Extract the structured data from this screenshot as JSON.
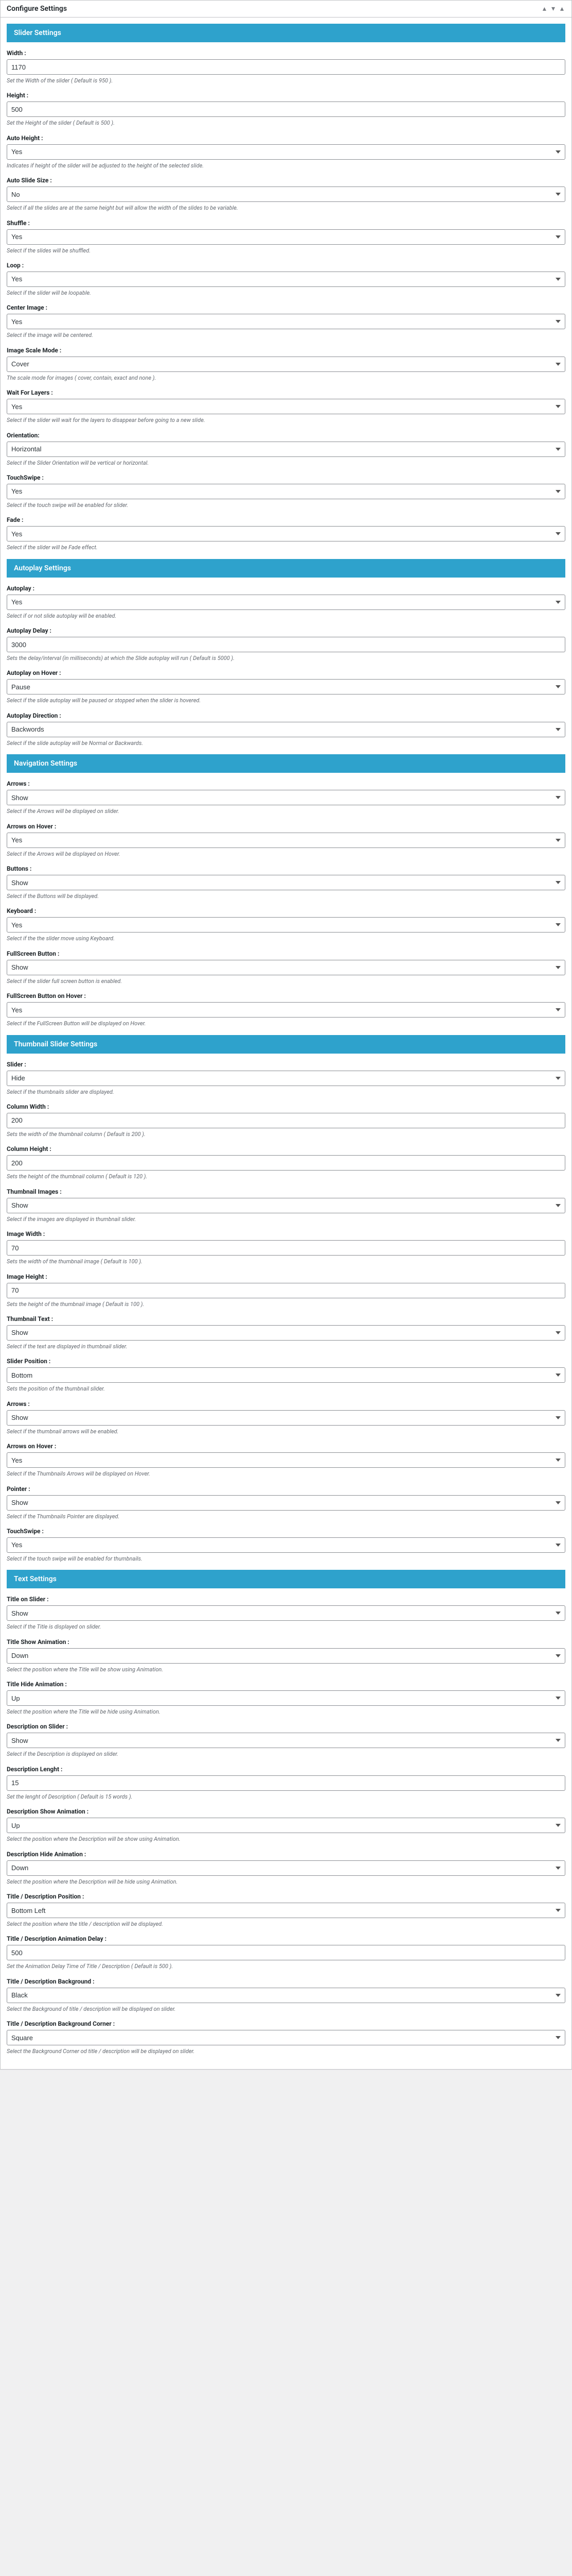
{
  "panel": {
    "title": "Configure Settings"
  },
  "sections": {
    "slider": {
      "title": "Slider Settings",
      "width": {
        "label": "Width :",
        "value": "1170",
        "hint": "Set the Width of the slider ( Default is 950 )."
      },
      "height": {
        "label": "Height :",
        "value": "500",
        "hint": "Set the Height of the slider ( Default is 500 )."
      },
      "autoHeight": {
        "label": "Auto Height :",
        "value": "Yes",
        "hint": "Indicates if height of the slider will be adjusted to the height of the selected slide."
      },
      "autoSlideSize": {
        "label": "Auto Slide Size :",
        "value": "No",
        "hint": "Select if all the slides are at the same height but will allow the width of the slides to be variable."
      },
      "shuffle": {
        "label": "Shuffle :",
        "value": "Yes",
        "hint": "Select if the slides will be shuffled."
      },
      "loop": {
        "label": "Loop :",
        "value": "Yes",
        "hint": "Select if the slider will be loopable."
      },
      "centerImage": {
        "label": "Center Image :",
        "value": "Yes",
        "hint": "Select if the image will be centered."
      },
      "imageScale": {
        "label": "Image Scale Mode :",
        "value": "Cover",
        "hint": "The scale mode for images ( cover, contain, exact and none )."
      },
      "waitLayers": {
        "label": "Wait For Layers :",
        "value": "Yes",
        "hint": "Select if the slider will wait for the layers to disappear before going to a new slide."
      },
      "orientation": {
        "label": "Orientation:",
        "value": "Horizontal",
        "hint": "Select if the Slider Orientation will be vertical or horizontal."
      },
      "touchSwipe": {
        "label": "TouchSwipe :",
        "value": "Yes",
        "hint": "Select if the touch swipe will be enabled for slider."
      },
      "fade": {
        "label": "Fade :",
        "value": "Yes",
        "hint": "Select if the slider will be Fade effect."
      }
    },
    "autoplay": {
      "title": "Autoplay Settings",
      "autoplay": {
        "label": "Autoplay :",
        "value": "Yes",
        "hint": "Select if or not slide autoplay will be enabled."
      },
      "autoplayDelay": {
        "label": "Autoplay Delay :",
        "value": "3000",
        "hint": "Sets the delay/interval (in milliseconds) at which the Slide autoplay will run ( Default is 5000 )."
      },
      "autoplayHover": {
        "label": "Autoplay on Hover :",
        "value": "Pause",
        "hint": "Select if the slide autoplay will be paused or stopped when the slider is hovered."
      },
      "autoplayDir": {
        "label": "Autoplay Direction :",
        "value": "Backwords",
        "hint": "Select if the slide autoplay will be Normal or Backwards."
      }
    },
    "navigation": {
      "title": "Navigation Settings",
      "arrows": {
        "label": "Arrows :",
        "value": "Show",
        "hint": "Select if the Arrows will be displayed on slider.",
        "blue": true
      },
      "arrowsHover": {
        "label": "Arrows on Hover :",
        "value": "Yes",
        "hint": "Select if the Arrows will be displayed on Hover."
      },
      "buttons": {
        "label": "Buttons :",
        "value": "Show",
        "hint": "Select if the Buttons will be displayed."
      },
      "keyboard": {
        "label": "Keyboard :",
        "value": "Yes",
        "hint": "Select if the the slider move using Keyboard."
      },
      "fsButton": {
        "label": "FullScreen Button :",
        "value": "Show",
        "hint": "Select if the slider full screen button is enabled."
      },
      "fsHover": {
        "label": "FullScreen Button on Hover :",
        "value": "Yes",
        "hint": "Select if the FullScreen Button will be displayed on Hover."
      }
    },
    "thumbnail": {
      "title": "Thumbnail Slider Settings",
      "slider": {
        "label": "Slider :",
        "value": "Hide",
        "hint": "Select if the thumbnails slider are displayed."
      },
      "colWidth": {
        "label": "Column Width :",
        "value": "200",
        "hint": "Sets the width of the thumbnail column ( Default is 200 )."
      },
      "colHeight": {
        "label": "Column Height :",
        "value": "200",
        "hint": "Sets the height of the thumbnail column ( Default is 120 )."
      },
      "images": {
        "label": "Thumbnail Images :",
        "value": "Show",
        "hint": "Select if the images are displayed in thumbnail slider."
      },
      "imgWidth": {
        "label": "Image Width :",
        "value": "70",
        "hint": "Sets the width of the thumbnail image ( Default is 100 )."
      },
      "imgHeight": {
        "label": "Image Height :",
        "value": "70",
        "hint": "Sets the height of the thumbnail image ( Default is 100 )."
      },
      "text": {
        "label": "Thumbnail Text :",
        "value": "Show",
        "hint": "Select if the text are displayed in thumbnail slider."
      },
      "position": {
        "label": "Slider Position :",
        "value": "Bottom",
        "hint": "Sets the position of the thumbnail slider."
      },
      "arrows": {
        "label": "Arrows :",
        "value": "Show",
        "hint": "Select if the thumbnail arrows will be enabled.",
        "blue": true
      },
      "arrowsHover": {
        "label": "Arrows on Hover :",
        "value": "Yes",
        "hint": "Select if the Thumbnails Arrows will be displayed on Hover."
      },
      "pointer": {
        "label": "Pointer :",
        "value": "Show",
        "hint": "Select if the Thumbnails Pointer are displayed."
      },
      "touchSwipe": {
        "label": "TouchSwipe :",
        "value": "Yes",
        "hint": "Select if the touch swipe will be enabled for thumbnails."
      }
    },
    "text": {
      "title": "Text Settings",
      "titleOnSlider": {
        "label": "Title on Slider :",
        "value": "Show",
        "hint": "Select if the Title is displayed on slider."
      },
      "titleShowAnim": {
        "label": "Title Show Animation :",
        "value": "Down",
        "hint": "Select the position where the Title will be show using Animation."
      },
      "titleHideAnim": {
        "label": "Title Hide Animation :",
        "value": "Up",
        "hint": "Select the position where the Title will be hide using Animation."
      },
      "descOnSlider": {
        "label": "Description on Slider :",
        "value": "Show",
        "hint": "Select if the Description is displayed on slider."
      },
      "descLength": {
        "label": "Description Lenght :",
        "value": "15",
        "hint": "Set the lenght of Description ( Default is 15 words )."
      },
      "descShowAnim": {
        "label": "Description Show Animation :",
        "value": "Up",
        "hint": "Select the position where the Description will be show using Animation."
      },
      "descHideAnim": {
        "label": "Description Hide Animation :",
        "value": "Down",
        "hint": "Select the position where the Description will be hide using Animation."
      },
      "position": {
        "label": "Title / Description Position :",
        "value": "Bottom Left",
        "hint": "Select the position where the title / description will be displayed."
      },
      "animDelay": {
        "label": "Title / Description Animation Delay :",
        "value": "500",
        "hint": "Set the Animation Delay Time of Title / Description ( Default is 500 )."
      },
      "bg": {
        "label": "Title / Description Background :",
        "value": "Black",
        "hint": "Select the Background of title / description will be displayed on slider."
      },
      "bgCorner": {
        "label": "Title / Description Background Corner :",
        "value": "Square",
        "hint": "Select the Background Corner od title / description will be displayed on slider."
      }
    }
  }
}
